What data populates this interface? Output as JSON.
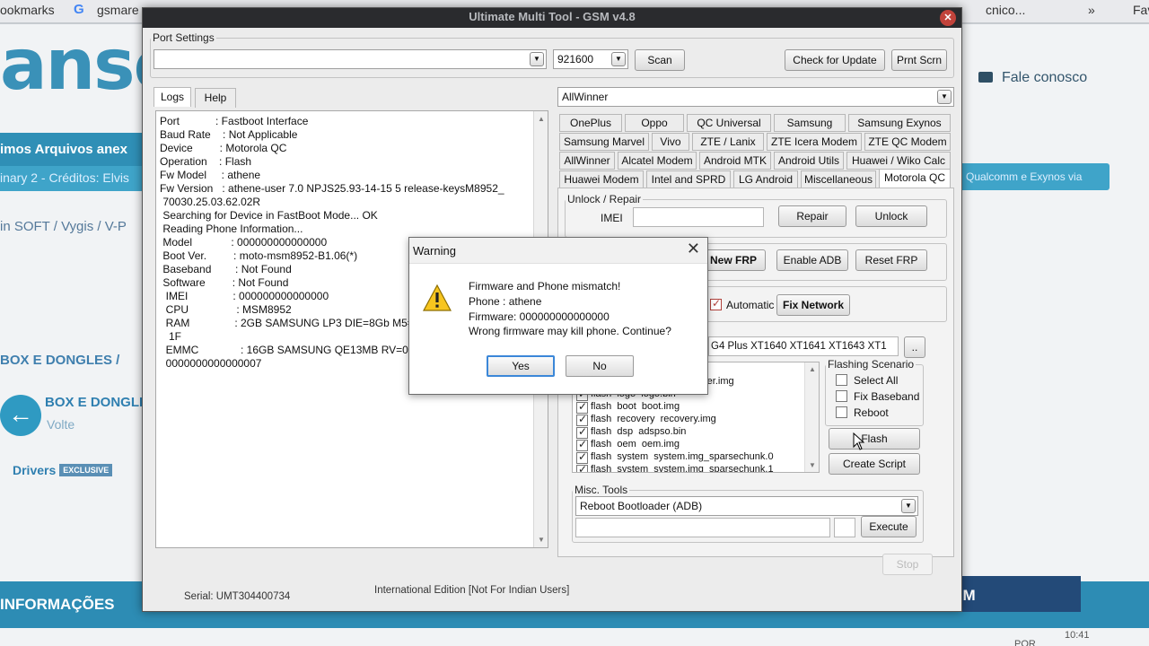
{
  "browser": {
    "bookmarks_label": "ookmarks",
    "bookmark_gsm": "gsmare",
    "tab_partial": "cnico...",
    "overflow": "»",
    "fav_partial": "Fav"
  },
  "site": {
    "logo": "anso",
    "fale_conosco": "Fale conosco",
    "band_text": "imos Arquivos anex",
    "ticker_left": "inary 2 - Créditos: Elvis",
    "ticker_right": "Qualcomm e Exynos via",
    "crumb": "in SOFT  /  Vygis / V-P",
    "box_dongles_menu": "BOX E DONGLES  /",
    "box_dongles_title": "BOX E DONGLES",
    "volte": "Volte",
    "drivers": "Drivers",
    "exclusive": "EXCLUSIVE",
    "informacoes": "INFORMAÇÕES",
    "gsm_banner": "GSM",
    "clock": "10:41",
    "lang": "POR"
  },
  "window": {
    "title": "Ultimate Multi Tool - GSM v4.8",
    "close": "✕",
    "port_settings_legend": "Port Settings",
    "port_value": "",
    "baud_value": "921600",
    "scan_label": "Scan",
    "check_update_label": "Check for Update",
    "print_screen_label": "Prnt Scrn",
    "left_tabs": [
      "Logs",
      "Help"
    ],
    "platform_value": "AllWinner",
    "status_serial": "Serial: UMT304400734",
    "status_edition": "International Edition [Not For Indian Users]",
    "stop_label": "Stop"
  },
  "logs": [
    "Port            : Fastboot Interface",
    "Baud Rate    : Not Applicable",
    "Device         : Motorola QC",
    "Operation    : Flash",
    "Fw Model     : athene",
    "Fw Version   : athene-user 7.0 NPJS25.93-14-15 5 release-keysM8952_",
    " 70030.25.03.62.02R",
    " Searching for Device in FastBoot Mode... OK",
    " Reading Phone Information...",
    " Model             : 000000000000000",
    " Boot Ver.         : moto-msm8952-B1.06(*)",
    " Baseband        : Not Found",
    " Software         : Not Found",
    "  IMEI               : 000000000000000",
    "  CPU                : MSM8952",
    "  RAM               : 2GB SAMSUNG LP3 DIE=8Gb M5=",
    "   1F",
    "  EMMC              : 16GB SAMSUNG QE13MB RV=08 F",
    "  0000000000000007"
  ],
  "brand_tabs": {
    "row1": [
      "OnePlus",
      "Oppo",
      "QC Universal",
      "Samsung",
      "Samsung Exynos"
    ],
    "row2": [
      "Samsung Marvel",
      "Vivo",
      "ZTE / Lanix",
      "ZTE Icera Modem",
      "ZTE QC Modem"
    ],
    "row3": [
      "AllWinner",
      "Alcatel Modem",
      "Android MTK",
      "Android Utils",
      "Huawei / Wiko Calc"
    ],
    "row4": [
      "Huawei Modem",
      "Intel and SPRD",
      "LG Android",
      "Miscellaneous",
      "Motorola QC"
    ]
  },
  "unlock": {
    "legend": "Unlock / Repair",
    "imei_label": "IMEI",
    "repair_label": "Repair",
    "unlock_label": "Unlock",
    "new_frp_label": "New FRP",
    "enable_adb_label": "Enable ADB",
    "reset_frp_label": "Reset FRP",
    "automatic_label": "Automatic",
    "fix_network_label": "Fix Network"
  },
  "flashing": {
    "model_value": "G4 Plus XT1640 XT1641 XT1643 XT1",
    "browse_label": "..",
    "files": [
      "flash  bootloader  bootloader.img",
      "flash  logo  logo.bin",
      "flash  boot  boot.img",
      "flash  recovery  recovery.img",
      "flash  dsp  adspso.bin",
      "flash  oem  oem.img",
      "flash  system  system.img_sparsechunk.0",
      "flash  system  system.img_sparsechunk.1"
    ],
    "scenario_legend": "Flashing Scenario",
    "select_all_label": "Select All",
    "fix_baseband_label": "Fix Baseband",
    "reboot_label": "Reboot",
    "flash_label": "Flash",
    "create_script_label": "Create Script"
  },
  "misc": {
    "legend": "Misc. Tools",
    "selected": "Reboot Bootloader (ADB)",
    "execute_label": "Execute"
  },
  "dialog": {
    "title": "Warning",
    "close": "✕",
    "line1": "Firmware and Phone mismatch!",
    "line2": "Phone : athene",
    "line3": "Firmware: 000000000000000",
    "line4": "Wrong firmware may kill phone. Continue?",
    "yes_label": "Yes",
    "no_label": "No",
    "icon": "warning-icon"
  }
}
